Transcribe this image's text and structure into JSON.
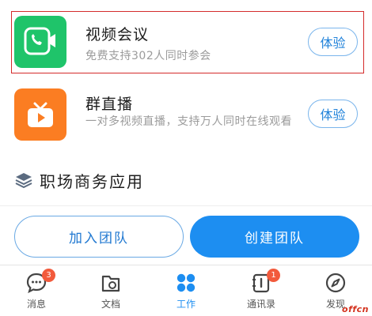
{
  "apps": [
    {
      "title": "视频会议",
      "description": "免费支持302人同时参会",
      "action_label": "体验",
      "icon": "phone-video-icon",
      "icon_bg": "#1fc46a"
    },
    {
      "title": "群直播",
      "description": "一对多视频直播，支持万人同时在线观看",
      "action_label": "体验",
      "icon": "tv-play-icon",
      "icon_bg": "#fb7d22"
    }
  ],
  "section": {
    "title": "职场商务应用",
    "icon": "layers-icon"
  },
  "team_actions": {
    "join_label": "加入团队",
    "create_label": "创建团队"
  },
  "tabbar": {
    "messages": {
      "label": "消息",
      "badge": "3",
      "icon": "chat-bubble-icon"
    },
    "docs": {
      "label": "文档",
      "icon": "document-icon"
    },
    "work": {
      "label": "工作",
      "icon": "grid-dots-icon"
    },
    "contacts": {
      "label": "通讯录",
      "badge": "1",
      "icon": "contacts-book-icon"
    },
    "discover": {
      "label": "发现",
      "icon": "compass-icon"
    }
  },
  "watermark": "offcn",
  "colors": {
    "accent": "#1d8ef1",
    "highlight_border": "#d42b2b",
    "badge": "#f25a3c"
  }
}
